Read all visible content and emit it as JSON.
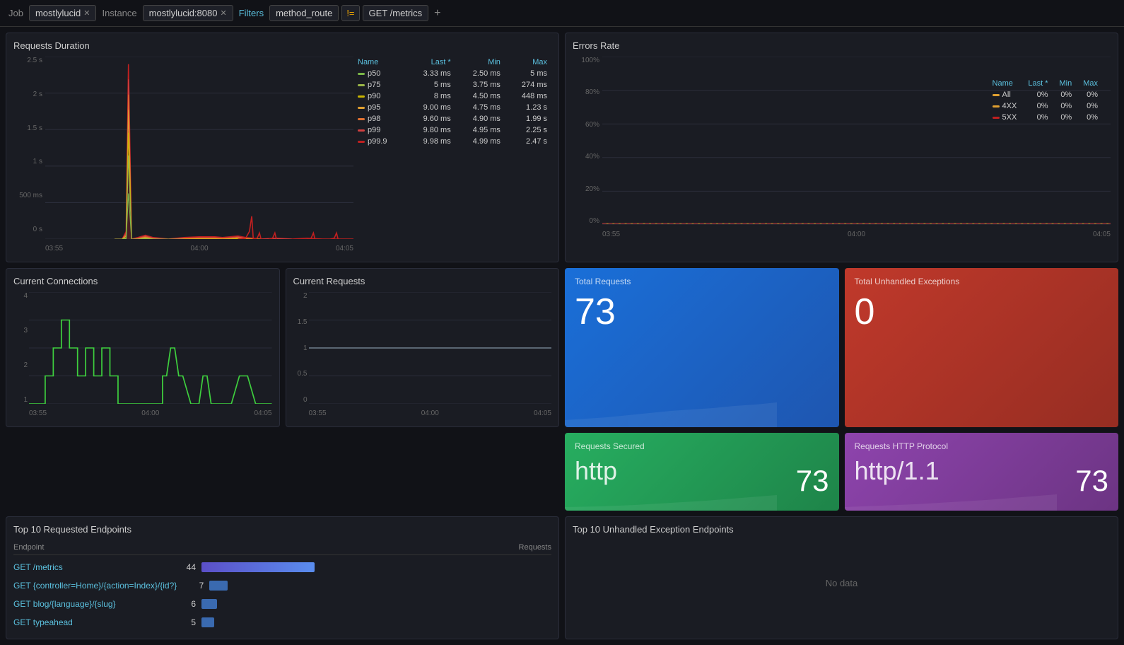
{
  "topbar": {
    "job_label": "Job",
    "job_value": "mostlylucid",
    "instance_label": "Instance",
    "instance_value": "mostlylucid:8080",
    "filters_label": "Filters",
    "filter1": "method_route",
    "filter_neq": "!=",
    "filter2": "GET /metrics",
    "add_filter": "+"
  },
  "requests_duration": {
    "title": "Requests Duration",
    "y_labels": [
      "2.5 s",
      "2 s",
      "1.5 s",
      "1 s",
      "500 ms",
      "0 s"
    ],
    "x_labels": [
      "03:55",
      "04:00",
      "04:05"
    ],
    "legend": {
      "headers": [
        "Name",
        "Last *",
        "Min",
        "Max"
      ],
      "rows": [
        {
          "name": "p50",
          "color": "#7ab648",
          "last": "3.33 ms",
          "min": "2.50 ms",
          "max": "5 ms"
        },
        {
          "name": "p75",
          "color": "#9ab648",
          "last": "5 ms",
          "min": "3.75 ms",
          "max": "274 ms"
        },
        {
          "name": "p90",
          "color": "#c8b400",
          "last": "8 ms",
          "min": "4.50 ms",
          "max": "448 ms"
        },
        {
          "name": "p95",
          "color": "#e0a030",
          "last": "9.00 ms",
          "min": "4.75 ms",
          "max": "1.23 s"
        },
        {
          "name": "p98",
          "color": "#e07030",
          "last": "9.60 ms",
          "min": "4.90 ms",
          "max": "1.99 s"
        },
        {
          "name": "p99",
          "color": "#d04040",
          "last": "9.80 ms",
          "min": "4.95 ms",
          "max": "2.25 s"
        },
        {
          "name": "p99.9",
          "color": "#c02020",
          "last": "9.98 ms",
          "min": "4.99 ms",
          "max": "2.47 s"
        }
      ]
    }
  },
  "errors_rate": {
    "title": "Errors Rate",
    "y_labels": [
      "100%",
      "80%",
      "60%",
      "40%",
      "20%",
      "0%"
    ],
    "x_labels": [
      "03:55",
      "04:00",
      "04:05"
    ],
    "legend": {
      "headers": [
        "Name",
        "Last *",
        "Min",
        "Max"
      ],
      "rows": [
        {
          "name": "All",
          "color": "#e0a030",
          "last": "0%",
          "min": "0%",
          "max": "0%"
        },
        {
          "name": "4XX",
          "color": "#e0a030",
          "last": "0%",
          "min": "0%",
          "max": "0%"
        },
        {
          "name": "5XX",
          "color": "#c02020",
          "last": "0%",
          "min": "0%",
          "max": "0%"
        }
      ]
    }
  },
  "current_connections": {
    "title": "Current Connections",
    "y_labels": [
      "4",
      "3",
      "2",
      "1"
    ],
    "x_labels": [
      "03:55",
      "04:00",
      "04:05"
    ]
  },
  "current_requests": {
    "title": "Current Requests",
    "y_labels": [
      "2",
      "1.5",
      "1",
      "0.5",
      "0"
    ],
    "x_labels": [
      "03:55",
      "04:00",
      "04:05"
    ]
  },
  "total_requests": {
    "title": "Total Requests",
    "value": "73"
  },
  "total_exceptions": {
    "title": "Total Unhandled Exceptions",
    "value": "0"
  },
  "requests_secured": {
    "title": "Requests Secured",
    "protocol": "http",
    "count": "73"
  },
  "requests_http": {
    "title": "Requests HTTP Protocol",
    "protocol": "http/1.1",
    "count": "73"
  },
  "top10_endpoints": {
    "title": "Top 10 Requested Endpoints",
    "col_endpoint": "Endpoint",
    "col_requests": "Requests",
    "rows": [
      {
        "name": "GET /metrics",
        "count": 44,
        "bar_pct": 100
      },
      {
        "name": "GET {controller=Home}/{action=Index}/{id?}",
        "count": 7,
        "bar_pct": 16
      },
      {
        "name": "GET blog/{language}/{slug}",
        "count": 6,
        "bar_pct": 14
      },
      {
        "name": "GET typeahead",
        "count": 5,
        "bar_pct": 11
      }
    ]
  },
  "top10_exceptions": {
    "title": "Top 10 Unhandled Exception Endpoints",
    "no_data": "No data"
  }
}
